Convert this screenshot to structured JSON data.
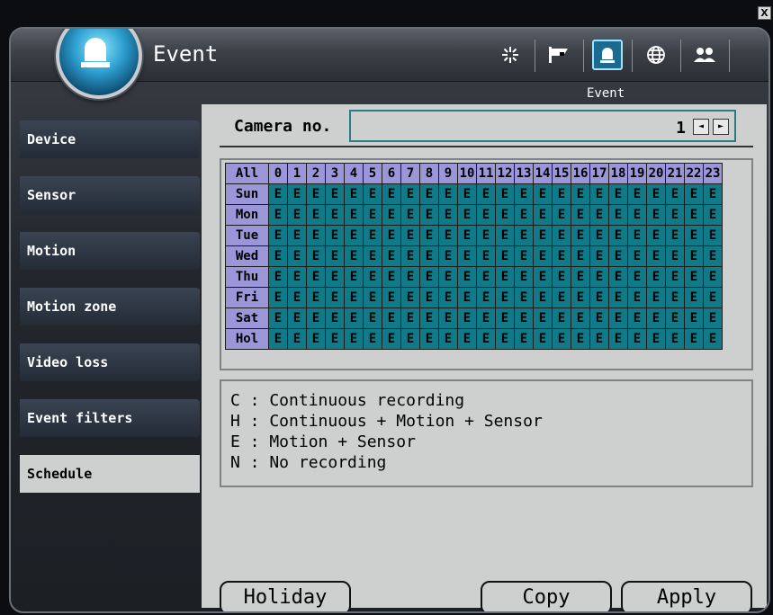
{
  "window": {
    "close_label": "X"
  },
  "header": {
    "title": "Event",
    "subtitle": "Event",
    "toolbar_icons": [
      "settings-icon",
      "camera-icon",
      "alarm-icon",
      "network-icon",
      "users-icon"
    ],
    "active_icon": "alarm-icon"
  },
  "sidebar": {
    "items": [
      {
        "label": "Device"
      },
      {
        "label": "Sensor"
      },
      {
        "label": "Motion"
      },
      {
        "label": "Motion zone"
      },
      {
        "label": "Video loss"
      },
      {
        "label": "Event filters"
      },
      {
        "label": "Schedule"
      }
    ],
    "active": "Schedule"
  },
  "camera": {
    "label": "Camera no.",
    "value": "1",
    "prev_glyph": "◄",
    "next_glyph": "►"
  },
  "schedule": {
    "corner": "All",
    "hours": [
      "0",
      "1",
      "2",
      "3",
      "4",
      "5",
      "6",
      "7",
      "8",
      "9",
      "10",
      "11",
      "12",
      "13",
      "14",
      "15",
      "16",
      "17",
      "18",
      "19",
      "20",
      "21",
      "22",
      "23"
    ],
    "rows": [
      {
        "day": "Sun",
        "cells": [
          "E",
          "E",
          "E",
          "E",
          "E",
          "E",
          "E",
          "E",
          "E",
          "E",
          "E",
          "E",
          "E",
          "E",
          "E",
          "E",
          "E",
          "E",
          "E",
          "E",
          "E",
          "E",
          "E",
          "E"
        ]
      },
      {
        "day": "Mon",
        "cells": [
          "E",
          "E",
          "E",
          "E",
          "E",
          "E",
          "E",
          "E",
          "E",
          "E",
          "E",
          "E",
          "E",
          "E",
          "E",
          "E",
          "E",
          "E",
          "E",
          "E",
          "E",
          "E",
          "E",
          "E"
        ]
      },
      {
        "day": "Tue",
        "cells": [
          "E",
          "E",
          "E",
          "E",
          "E",
          "E",
          "E",
          "E",
          "E",
          "E",
          "E",
          "E",
          "E",
          "E",
          "E",
          "E",
          "E",
          "E",
          "E",
          "E",
          "E",
          "E",
          "E",
          "E"
        ]
      },
      {
        "day": "Wed",
        "cells": [
          "E",
          "E",
          "E",
          "E",
          "E",
          "E",
          "E",
          "E",
          "E",
          "E",
          "E",
          "E",
          "E",
          "E",
          "E",
          "E",
          "E",
          "E",
          "E",
          "E",
          "E",
          "E",
          "E",
          "E"
        ]
      },
      {
        "day": "Thu",
        "cells": [
          "E",
          "E",
          "E",
          "E",
          "E",
          "E",
          "E",
          "E",
          "E",
          "E",
          "E",
          "E",
          "E",
          "E",
          "E",
          "E",
          "E",
          "E",
          "E",
          "E",
          "E",
          "E",
          "E",
          "E"
        ]
      },
      {
        "day": "Fri",
        "cells": [
          "E",
          "E",
          "E",
          "E",
          "E",
          "E",
          "E",
          "E",
          "E",
          "E",
          "E",
          "E",
          "E",
          "E",
          "E",
          "E",
          "E",
          "E",
          "E",
          "E",
          "E",
          "E",
          "E",
          "E"
        ]
      },
      {
        "day": "Sat",
        "cells": [
          "E",
          "E",
          "E",
          "E",
          "E",
          "E",
          "E",
          "E",
          "E",
          "E",
          "E",
          "E",
          "E",
          "E",
          "E",
          "E",
          "E",
          "E",
          "E",
          "E",
          "E",
          "E",
          "E",
          "E"
        ]
      },
      {
        "day": "Hol",
        "cells": [
          "E",
          "E",
          "E",
          "E",
          "E",
          "E",
          "E",
          "E",
          "E",
          "E",
          "E",
          "E",
          "E",
          "E",
          "E",
          "E",
          "E",
          "E",
          "E",
          "E",
          "E",
          "E",
          "E",
          "E"
        ]
      }
    ]
  },
  "legend": [
    "C : Continuous recording",
    "H : Continuous + Motion + Sensor",
    "E : Motion + Sensor",
    "N : No recording"
  ],
  "buttons": {
    "holiday": "Holiday",
    "copy": "Copy",
    "apply": "Apply"
  },
  "colors": {
    "header_cell": "#9a96d8",
    "schedule_cell": "#0f7b88",
    "panel_bg": "#cdd0cf",
    "accent": "#2d9fd0"
  }
}
